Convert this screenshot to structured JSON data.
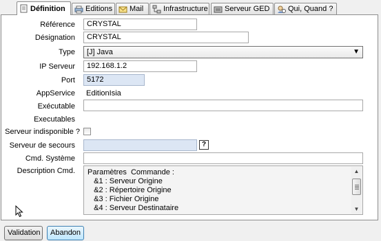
{
  "tabs": [
    {
      "label": "Définition",
      "icon": "document-icon",
      "active": true
    },
    {
      "label": "Editions",
      "icon": "printer-icon"
    },
    {
      "label": "Mail",
      "icon": "envelope-icon"
    },
    {
      "label": "Infrastructure",
      "icon": "network-icon"
    },
    {
      "label": "Serveur GED",
      "icon": "server-icon"
    },
    {
      "label": "Qui, Quand ?",
      "icon": "user-clock-icon"
    }
  ],
  "form": {
    "reference": {
      "label": "Référence",
      "value": "CRYSTAL"
    },
    "designation": {
      "label": "Désignation",
      "value": "CRYSTAL"
    },
    "type": {
      "label": "Type",
      "value": "[J] Java"
    },
    "ip": {
      "label": "IP Serveur",
      "value": "192.168.1.2"
    },
    "port": {
      "label": "Port",
      "value": "5172"
    },
    "appservice": {
      "label": "AppService",
      "value": "EditionIsia"
    },
    "executable": {
      "label": "Exécutable",
      "value": ""
    },
    "executables": {
      "label": "Executables"
    },
    "indisponible": {
      "label": "Serveur indisponible ?",
      "checked": false
    },
    "secours": {
      "label": "Serveur de secours",
      "value": "",
      "help": "?"
    },
    "cmd_systeme": {
      "label": "Cmd. Système",
      "value": ""
    },
    "description": {
      "label": "Description Cmd.",
      "lines": [
        "Paramètres  Commande :",
        "   &1 : Serveur Origine",
        "   &2 : Répertoire Origine",
        "   &3 : Fichier Origine",
        "   &4 : Serveur Destinataire"
      ]
    }
  },
  "buttons": {
    "validation": "Validation",
    "abandon": "Abandon"
  },
  "colors": {
    "input_blue": "#dce6f4",
    "focus_button": "#bee6fd"
  }
}
